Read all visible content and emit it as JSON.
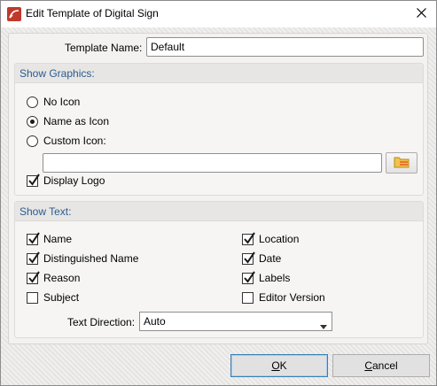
{
  "window": {
    "title": "Edit Template of Digital Sign"
  },
  "template_name": {
    "label": "Template Name:",
    "value": "Default"
  },
  "show_graphics": {
    "title": "Show Graphics:",
    "options": [
      {
        "label": "No Icon",
        "selected": false
      },
      {
        "label": "Name as Icon",
        "selected": true
      },
      {
        "label": "Custom Icon:",
        "selected": false
      }
    ],
    "custom_icon_path": "",
    "display_logo": {
      "label": "Display Logo",
      "checked": true
    }
  },
  "show_text": {
    "title": "Show Text:",
    "left_column": [
      {
        "label": "Name",
        "checked": true
      },
      {
        "label": "Distinguished Name",
        "checked": true
      },
      {
        "label": "Reason",
        "checked": true
      },
      {
        "label": "Subject",
        "checked": false
      }
    ],
    "right_column": [
      {
        "label": "Location",
        "checked": true
      },
      {
        "label": "Date",
        "checked": true
      },
      {
        "label": "Labels",
        "checked": true
      },
      {
        "label": "Editor Version",
        "checked": false
      }
    ],
    "text_direction": {
      "label": "Text Direction:",
      "value": "Auto"
    }
  },
  "buttons": {
    "ok": "OK",
    "cancel": "Cancel"
  },
  "icons": {
    "app": "pdf-editor-icon",
    "close": "close-icon",
    "browse": "folder-icon",
    "dropdown": "chevron-down-icon",
    "check": "checkmark-icon"
  },
  "colors": {
    "group_title": "#2a5b8f",
    "default_button_border": "#3c7fb1"
  }
}
